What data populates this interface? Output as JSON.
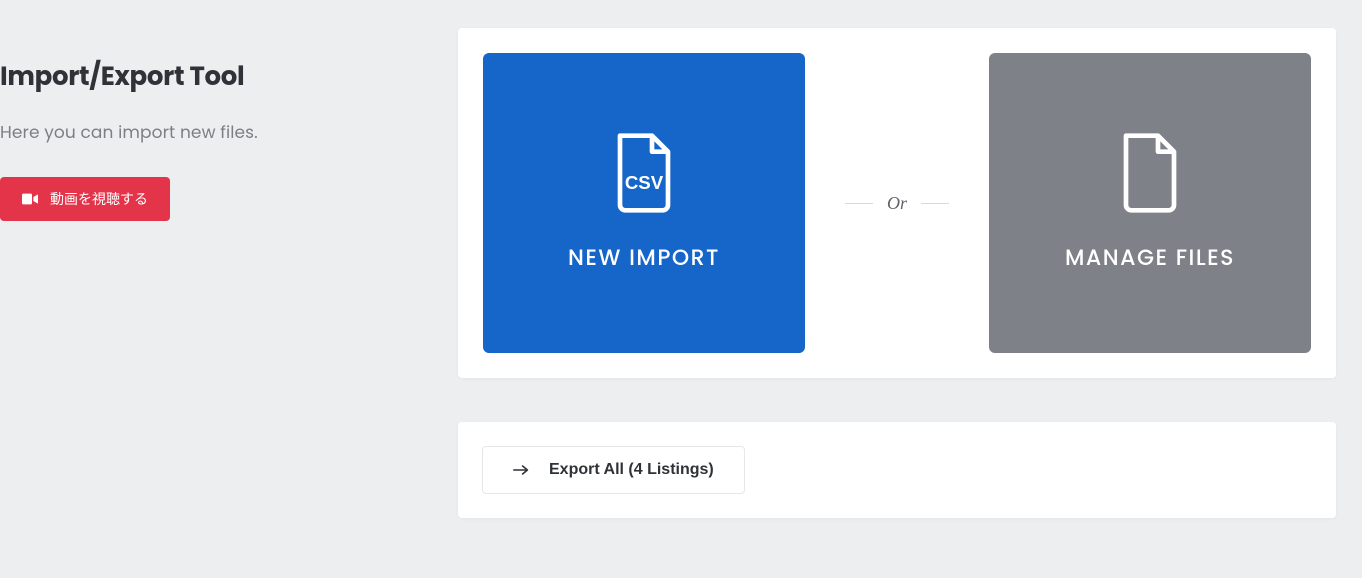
{
  "sidebar": {
    "title": "Import/Export Tool",
    "subtitle": "Here you can import new files.",
    "video_button_label": "動画を視聴する"
  },
  "tiles": {
    "new_import_label": "NEW IMPORT",
    "manage_files_label": "MANAGE FILES",
    "or_label": "Or"
  },
  "export": {
    "button_label": "Export All (4 Listings)"
  }
}
